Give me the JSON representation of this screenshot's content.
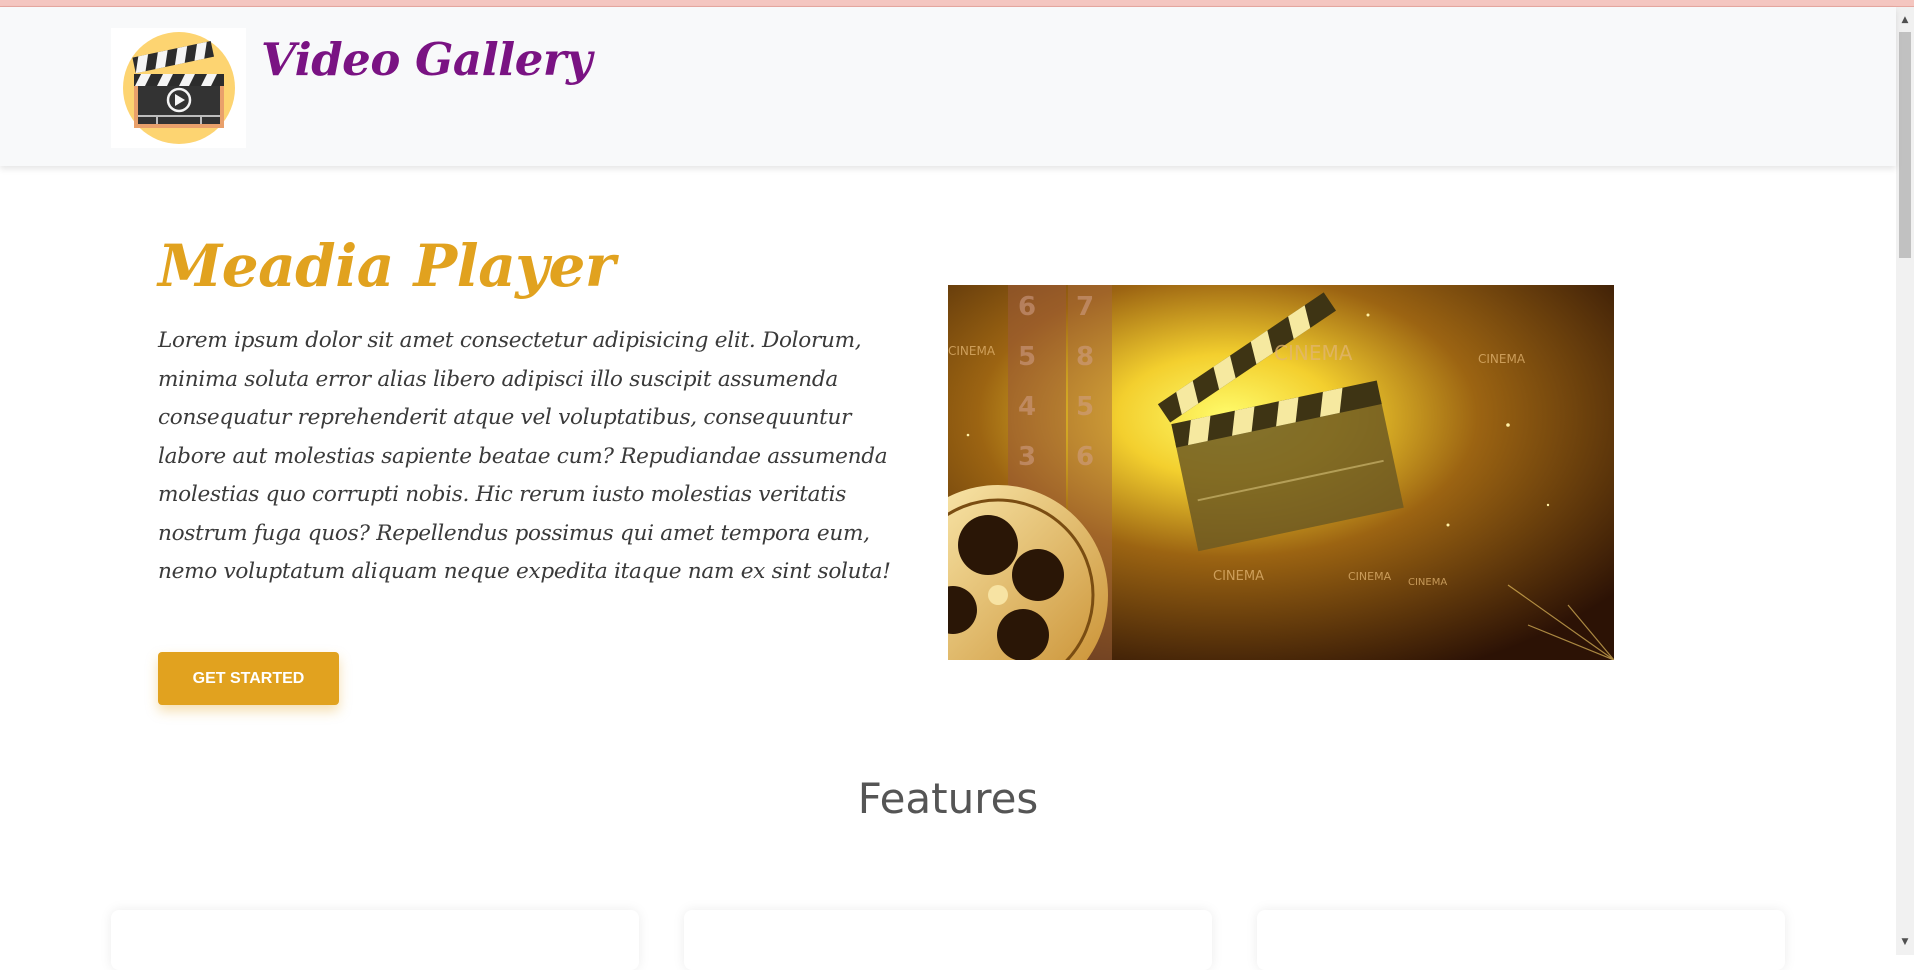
{
  "navbar": {
    "brand_title": "Video Gallery",
    "logo_icon": "clapperboard-play-icon"
  },
  "hero": {
    "title": "Meadia Player",
    "description": "Lorem ipsum dolor sit amet consectetur adipisicing elit. Dolorum, minima soluta error alias libero adipisci illo suscipit assumenda consequatur reprehenderit atque vel voluptatibus, consequuntur labore aut molestias sapiente beatae cum? Repudiandae assumenda molestias quo corrupti nobis. Hic rerum iusto molestias veritatis nostrum fuga quos? Repellendus possimus qui amet tempora eum, nemo voluptatum aliquam neque expedita itaque nam ex sint soluta!",
    "cta_label": "GET STARTED",
    "image_text": "CINEMA",
    "image_icon": "film-reel-clapperboard-icon"
  },
  "features": {
    "title": "Features"
  },
  "colors": {
    "brand_purple": "#7a1383",
    "accent_gold": "#e1a21f"
  }
}
